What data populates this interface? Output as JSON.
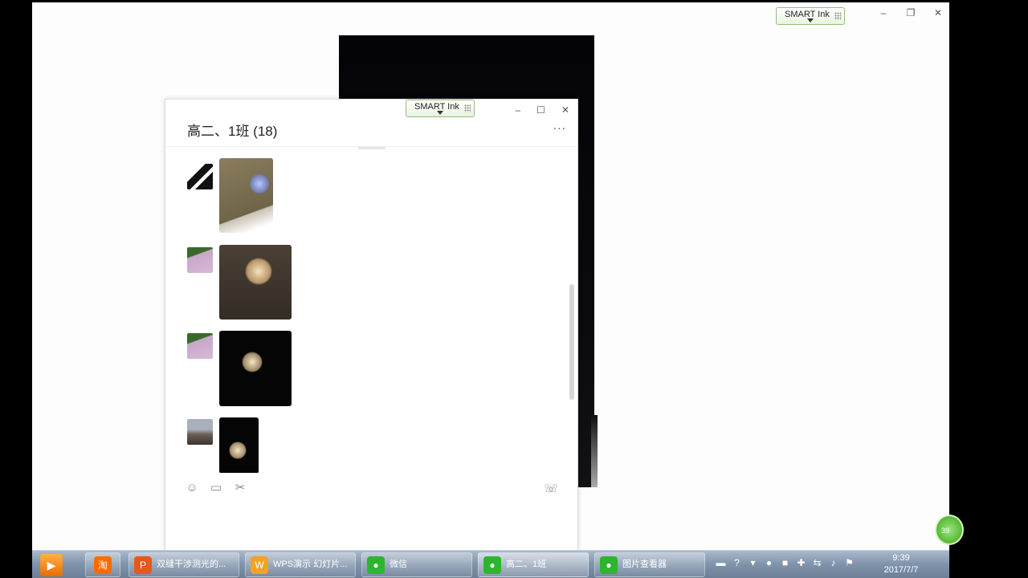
{
  "screen": {
    "controls": {
      "minimize": "–",
      "restore": "❐",
      "close": "✕"
    },
    "smart_ink_label": "SMART Ink"
  },
  "chat_window": {
    "title": "高二、1班 (18)",
    "smart_ink_label": "SMART Ink",
    "more_label": "...",
    "controls": {
      "minimize": "–",
      "maximize": "☐",
      "close": "✕"
    },
    "toolbar": {
      "emoji_icon": "emoji-icon",
      "folder_icon": "folder-icon",
      "scissors_icon": "scissors-icon",
      "call_icon": "voice-call-icon"
    }
  },
  "taskbar": {
    "items": [
      {
        "label": "",
        "icon": "media-player-icon",
        "color": "#f08a1a"
      },
      {
        "label": "",
        "icon": "taobao-icon",
        "color": "#ff6a00",
        "glyph": "淘"
      },
      {
        "label": "双缝干涉测光的...",
        "icon": "wps-presentation-icon",
        "color": "#e8581c"
      },
      {
        "label": "WPS演示 幻灯片...",
        "icon": "wps-slides-icon",
        "color": "#f0a22a"
      },
      {
        "label": "微信",
        "icon": "wechat-icon",
        "color": "#2db52e"
      },
      {
        "label": "高二、1班",
        "icon": "wechat-icon",
        "color": "#2db52e"
      },
      {
        "label": "图片查看器",
        "icon": "wechat-icon",
        "color": "#2db52e"
      }
    ],
    "clock_time": "9:39",
    "clock_date": "2017/7/7",
    "badge_text": "39"
  }
}
